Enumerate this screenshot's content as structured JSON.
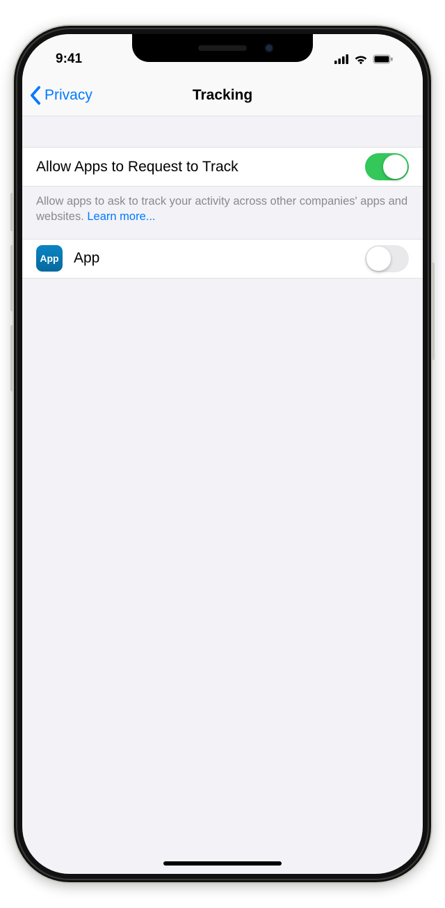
{
  "status": {
    "time": "9:41"
  },
  "nav": {
    "back_label": "Privacy",
    "title": "Tracking"
  },
  "allow_section": {
    "label": "Allow Apps to Request to Track",
    "toggle_on": true,
    "footer_text": "Allow apps to ask to track your activity across other companies' apps and websites. ",
    "learn_more_label": "Learn more..."
  },
  "apps": [
    {
      "icon_text": "App",
      "name": "App",
      "toggle_on": false
    }
  ]
}
